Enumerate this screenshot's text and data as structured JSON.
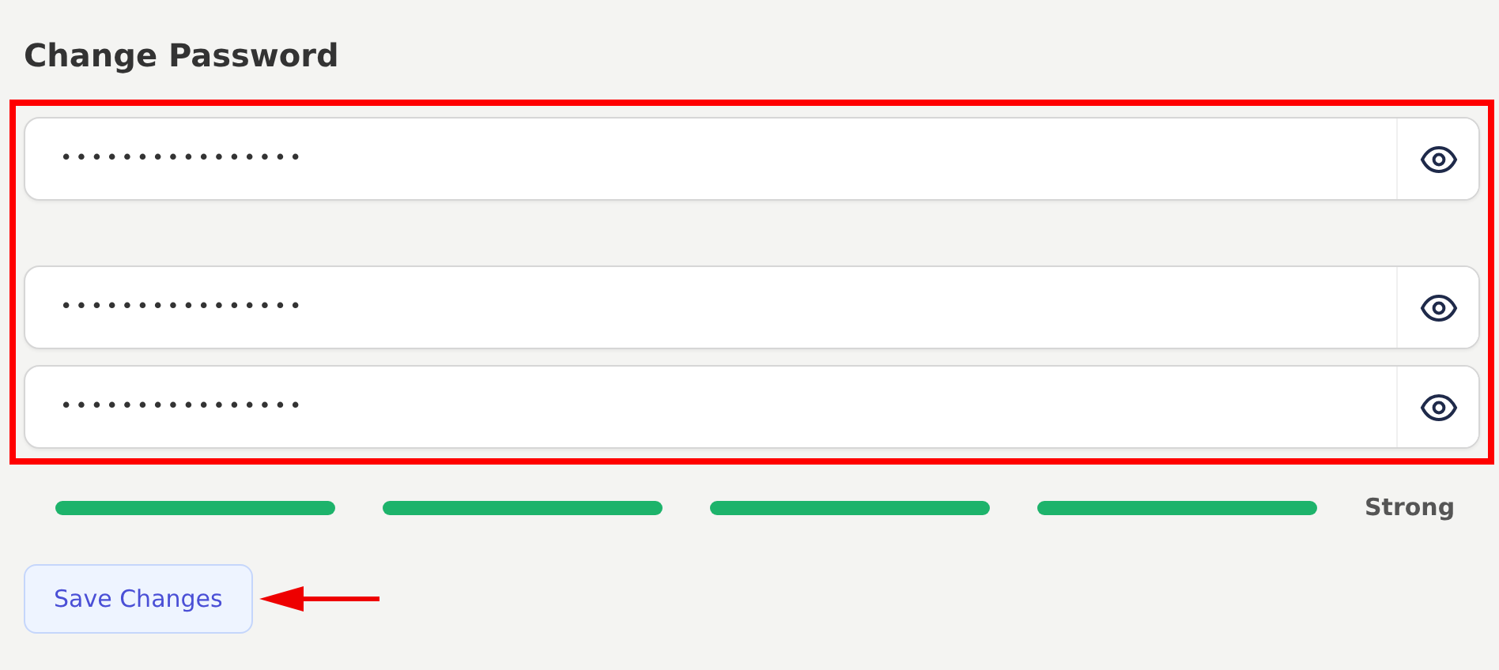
{
  "title": "Change Password",
  "highlight_box": true,
  "fields": [
    {
      "value": "••••••••••••••••"
    },
    {
      "value": "••••••••••••••••"
    },
    {
      "value": "••••••••••••••••"
    }
  ],
  "strength": {
    "segments": [
      {
        "filled": true
      },
      {
        "filled": true
      },
      {
        "filled": true
      },
      {
        "filled": true
      }
    ],
    "label": "Strong"
  },
  "save_button": "Save Changes",
  "pointer_arrow": true
}
